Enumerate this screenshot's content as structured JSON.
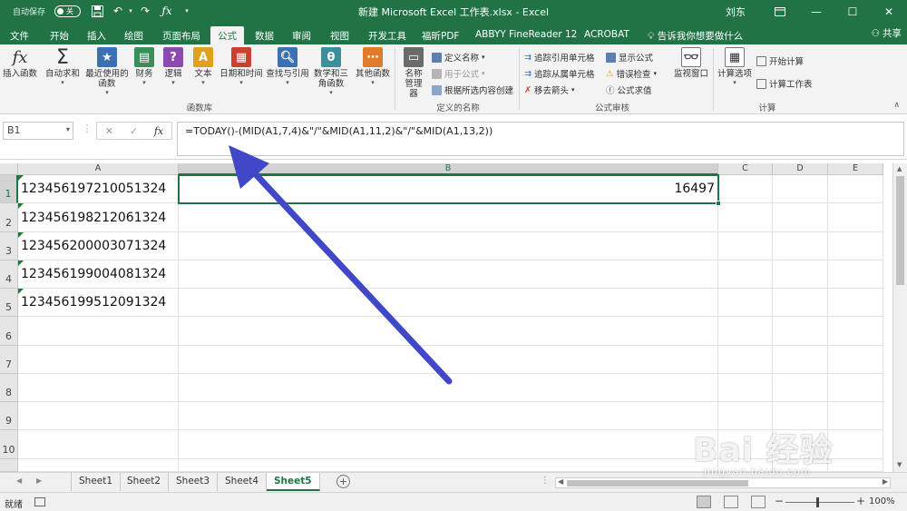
{
  "titlebar": {
    "autosave_label": "自动保存",
    "autosave_state": "关",
    "title": "新建 Microsoft Excel 工作表.xlsx  -  Excel",
    "user": "刘东",
    "minimize": "—",
    "maximize": "☐",
    "close": "✕",
    "restore": "▣"
  },
  "tabs": [
    "文件",
    "开始",
    "插入",
    "绘图",
    "页面布局",
    "公式",
    "数据",
    "审阅",
    "视图",
    "开发工具",
    "福昕PDF",
    "ABBYY FineReader 12",
    "ACROBAT"
  ],
  "active_tab": "公式",
  "tell_me": "告诉我你想要做什么",
  "share": "共享",
  "ribbon": {
    "function_library": {
      "label": "函数库",
      "buttons": [
        {
          "label": "插入函数",
          "icon": "insert-function-icon"
        },
        {
          "label": "自动求和",
          "icon": "autosum-icon"
        },
        {
          "label": "最近使用的函数",
          "icon": "recent-functions-icon"
        },
        {
          "label": "财务",
          "icon": "financial-icon"
        },
        {
          "label": "逻辑",
          "icon": "logical-icon"
        },
        {
          "label": "文本",
          "icon": "text-icon"
        },
        {
          "label": "日期和时间",
          "icon": "date-time-icon"
        },
        {
          "label": "查找与引用",
          "icon": "lookup-icon"
        },
        {
          "label": "数学和三角函数",
          "icon": "math-trig-icon"
        },
        {
          "label": "其他函数",
          "icon": "more-functions-icon"
        }
      ]
    },
    "defined_names": {
      "label": "定义的名称",
      "name_manager": "名称管理器",
      "define_name": "定义名称",
      "use_in_formula": "用于公式",
      "create_from_selection": "根据所选内容创建"
    },
    "formula_auditing": {
      "label": "公式审核",
      "trace_precedents": "追踪引用单元格",
      "trace_dependents": "追踪从属单元格",
      "remove_arrows": "移去箭头",
      "show_formulas": "显示公式",
      "error_checking": "错误检查",
      "evaluate_formula": "公式求值",
      "watch_window": "监视窗口"
    },
    "calculation": {
      "label": "计算",
      "calc_options": "计算选项",
      "calc_now": "开始计算",
      "calc_sheet": "计算工作表"
    }
  },
  "formula_bar": {
    "name_box": "B1",
    "formula": "=TODAY()-(MID(A1,7,4)&\"/\"&MID(A1,11,2)&\"/\"&MID(A1,13,2))",
    "cancel": "✕",
    "enter": "✓",
    "fx": "fx"
  },
  "columns": [
    "A",
    "B",
    "C",
    "D",
    "E"
  ],
  "rows": [
    "1",
    "2",
    "3",
    "4",
    "5",
    "6",
    "7",
    "8",
    "9",
    "10"
  ],
  "cells": {
    "A1": "123456197210051324",
    "A2": "123456198212061324",
    "A3": "123456200003071324",
    "A4": "123456199004081324",
    "A5": "123456199512091324",
    "B1": "16497"
  },
  "sheets": [
    "Sheet1",
    "Sheet2",
    "Sheet3",
    "Sheet4",
    "Sheet5"
  ],
  "active_sheet": "Sheet5",
  "status": {
    "ready": "就绪",
    "zoom": "100%",
    "zoom_minus": "−",
    "zoom_plus": "+"
  },
  "watermark": {
    "brand": "Bai  经验",
    "url": "jingyan.baidu.com"
  },
  "colors": {
    "excel_green": "#217346",
    "arrow": "#4048c8"
  }
}
